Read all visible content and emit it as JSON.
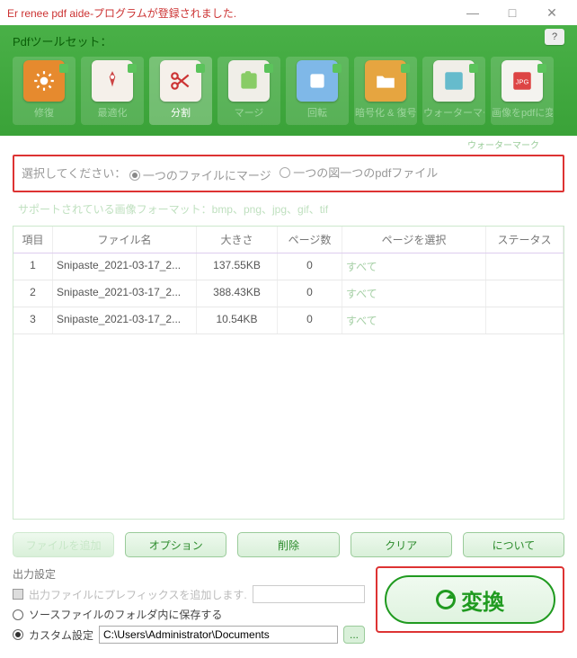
{
  "titlebar": {
    "title": "Er renee pdf aide-プログラムが登録されました."
  },
  "header": {
    "label": "Pdfツールセット：",
    "watermark": "ウォーターマーク"
  },
  "tools": [
    {
      "name": "修復",
      "bg": "#e68a2e"
    },
    {
      "name": "最適化",
      "bg": "#f5f0ea"
    },
    {
      "name": "分割",
      "bg": "#f5f0ea",
      "active": true
    },
    {
      "name": "マージ",
      "bg": "#f0eee8"
    },
    {
      "name": "回転",
      "bg": "#7fb8e8"
    },
    {
      "name": "暗号化 & 復号化",
      "bg": "#e6a540"
    },
    {
      "name": "ウォーターマーク",
      "bg": "#f0eee8"
    },
    {
      "name": "画像をpdfに変換",
      "bg": "#f4f3ef"
    }
  ],
  "select": {
    "label": "選択してください：",
    "opt1": "一つのファイルにマージ",
    "opt2": "一つの図一つのpdfファイル"
  },
  "formats": "サポートされている画像フォーマット：bmp、png、jpg、gif、tif",
  "table": {
    "h0": "項目",
    "h1": "ファイル名",
    "h2": "大きさ",
    "h3": "ページ数",
    "h4": "ページを選択",
    "h5": "ステータス",
    "rows": [
      {
        "idx": "1",
        "name": "Snipaste_2021-03-17_2...",
        "size": "137.55KB",
        "pages": "0",
        "sel": "すべて"
      },
      {
        "idx": "2",
        "name": "Snipaste_2021-03-17_2...",
        "size": "388.43KB",
        "pages": "0",
        "sel": "すべて"
      },
      {
        "idx": "3",
        "name": "Snipaste_2021-03-17_2...",
        "size": "10.54KB",
        "pages": "0",
        "sel": "すべて"
      }
    ]
  },
  "buttons": {
    "add": "ファイルを追加",
    "opt": "オプション",
    "del": "削除",
    "clr": "クリア",
    "about": "について"
  },
  "output": {
    "h": "出力設定",
    "prefix": "出力ファイルにプレフィックスを追加します.",
    "prefix_val": "",
    "samefolder": "ソースファイルのフォルダ内に保存する",
    "custom": "カスタム設定",
    "path": "C:\\Users\\Administrator\\Documents",
    "browse": "..."
  },
  "convert": "変換"
}
